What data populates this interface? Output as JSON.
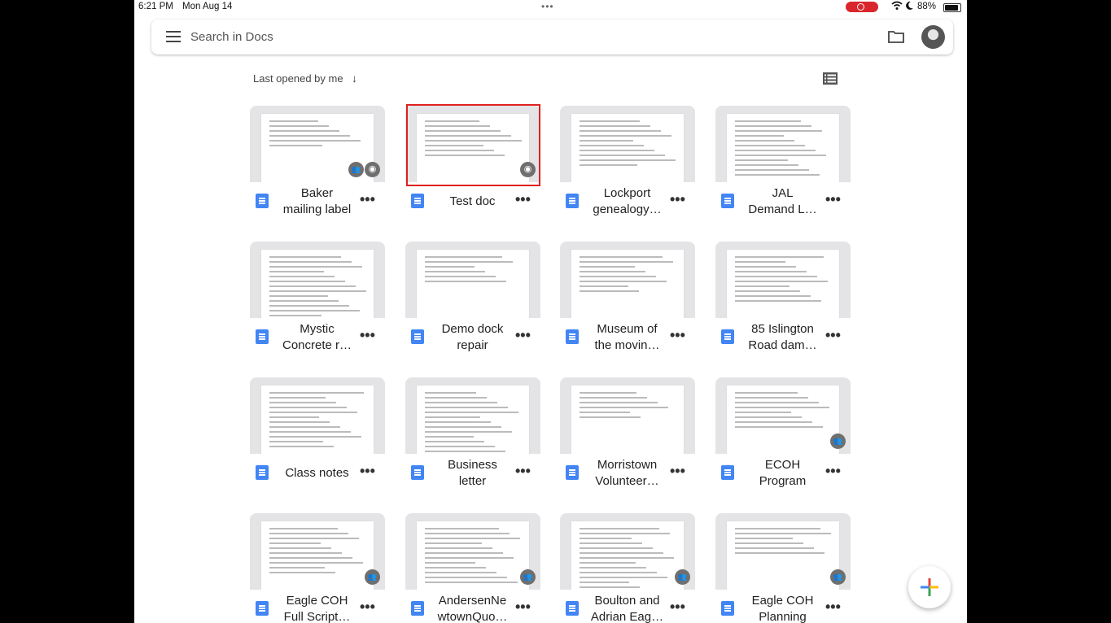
{
  "status_bar": {
    "time": "6:21 PM",
    "date": "Mon Aug 14",
    "dots": "•••",
    "battery": "88%",
    "wifi": "wifi-icon",
    "moon": "moon-icon"
  },
  "search": {
    "placeholder": "Search in Docs"
  },
  "sort": {
    "label": "Last opened by me",
    "arrow": "↓"
  },
  "documents": [
    {
      "title": "Baker\nmailing label",
      "badges": [
        "shared",
        "offline"
      ]
    },
    {
      "title": "Test doc",
      "badges": [
        "offline"
      ]
    },
    {
      "title": "Lockport\ngenealogy…",
      "badges": []
    },
    {
      "title": "JAL\nDemand L…",
      "badges": []
    },
    {
      "title": "Mystic\nConcrete r…",
      "badges": []
    },
    {
      "title": "Demo dock\nrepair",
      "badges": []
    },
    {
      "title": "Museum of\nthe movin…",
      "badges": []
    },
    {
      "title": "85 Islington\nRoad dam…",
      "badges": []
    },
    {
      "title": "Class notes",
      "badges": []
    },
    {
      "title": "Business\nletter",
      "badges": []
    },
    {
      "title": "Morristown\nVolunteer…",
      "badges": []
    },
    {
      "title": "ECOH\nProgram",
      "badges": [
        "shared"
      ]
    },
    {
      "title": "Eagle COH\nFull Script…",
      "badges": [
        "shared"
      ]
    },
    {
      "title": "AndersenNe\nwtownQuo…",
      "badges": [
        "shared"
      ]
    },
    {
      "title": "Boulton and\nAdrian Eag…",
      "badges": [
        "shared"
      ]
    },
    {
      "title": "Eagle COH\nPlanning",
      "badges": [
        "shared"
      ]
    }
  ],
  "more_label": "•••",
  "colors": {
    "docs_blue": "#4285f4",
    "highlight": "#e02020"
  }
}
